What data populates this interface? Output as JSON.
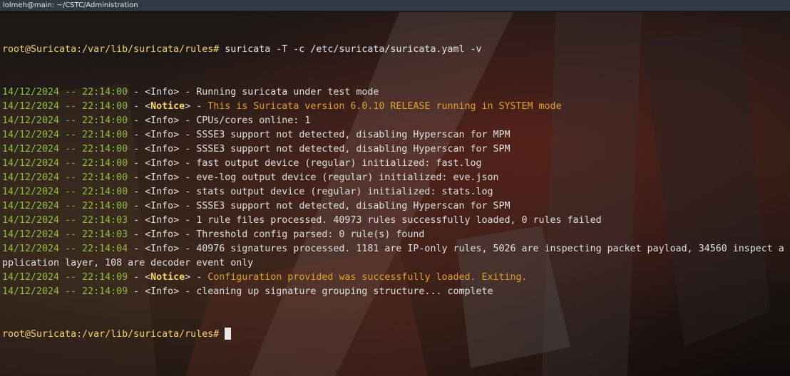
{
  "window": {
    "title": "lolmeh@main: ~/CSTC/Administration"
  },
  "command": {
    "prompt": "root@Suricata:/var/lib/suricata/rules#",
    "text": " suricata -T -c /etc/suricata/suricata.yaml -v"
  },
  "log_lines": [
    {
      "ts": "14/12/2024 -- 22:14:00",
      "sep1": " - <",
      "tag": "Info",
      "sep2": "> - ",
      "msg": "Running suricata under test mode",
      "level": "info"
    },
    {
      "ts": "14/12/2024 -- 22:14:00",
      "sep1": " - <",
      "tag": "Notice",
      "sep2": "> - ",
      "msg": "This is Suricata version 6.0.10 RELEASE running in SYSTEM mode",
      "level": "notice"
    },
    {
      "ts": "14/12/2024 -- 22:14:00",
      "sep1": " - <",
      "tag": "Info",
      "sep2": "> - ",
      "msg": "CPUs/cores online: 1",
      "level": "info"
    },
    {
      "ts": "14/12/2024 -- 22:14:00",
      "sep1": " - <",
      "tag": "Info",
      "sep2": "> - ",
      "msg": "SSSE3 support not detected, disabling Hyperscan for MPM",
      "level": "info"
    },
    {
      "ts": "14/12/2024 -- 22:14:00",
      "sep1": " - <",
      "tag": "Info",
      "sep2": "> - ",
      "msg": "SSSE3 support not detected, disabling Hyperscan for SPM",
      "level": "info"
    },
    {
      "ts": "14/12/2024 -- 22:14:00",
      "sep1": " - <",
      "tag": "Info",
      "sep2": "> - ",
      "msg": "fast output device (regular) initialized: fast.log",
      "level": "info"
    },
    {
      "ts": "14/12/2024 -- 22:14:00",
      "sep1": " - <",
      "tag": "Info",
      "sep2": "> - ",
      "msg": "eve-log output device (regular) initialized: eve.json",
      "level": "info"
    },
    {
      "ts": "14/12/2024 -- 22:14:00",
      "sep1": " - <",
      "tag": "Info",
      "sep2": "> - ",
      "msg": "stats output device (regular) initialized: stats.log",
      "level": "info"
    },
    {
      "ts": "14/12/2024 -- 22:14:00",
      "sep1": " - <",
      "tag": "Info",
      "sep2": "> - ",
      "msg": "SSSE3 support not detected, disabling Hyperscan for SPM",
      "level": "info"
    },
    {
      "ts": "14/12/2024 -- 22:14:03",
      "sep1": " - <",
      "tag": "Info",
      "sep2": "> - ",
      "msg": "1 rule files processed. 40973 rules successfully loaded, 0 rules failed",
      "level": "info"
    },
    {
      "ts": "14/12/2024 -- 22:14:03",
      "sep1": " - <",
      "tag": "Info",
      "sep2": "> - ",
      "msg": "Threshold config parsed: 0 rule(s) found",
      "level": "info"
    },
    {
      "ts": "14/12/2024 -- 22:14:04",
      "sep1": " - <",
      "tag": "Info",
      "sep2": "> - ",
      "msg": "40976 signatures processed. 1181 are IP-only rules, 5026 are inspecting packet payload, 34560 inspect application layer, 108 are decoder event only",
      "level": "info"
    },
    {
      "ts": "14/12/2024 -- 22:14:09",
      "sep1": " - <",
      "tag": "Notice",
      "sep2": "> - ",
      "msg": "Configuration provided was successfully loaded. Exiting.",
      "level": "notice"
    },
    {
      "ts": "14/12/2024 -- 22:14:09",
      "sep1": " - <",
      "tag": "Info",
      "sep2": "> - ",
      "msg": "cleaning up signature grouping structure... complete",
      "level": "info"
    }
  ],
  "final_prompt": {
    "prompt": "root@Suricata:/var/lib/suricata/rules#",
    "text": " "
  }
}
